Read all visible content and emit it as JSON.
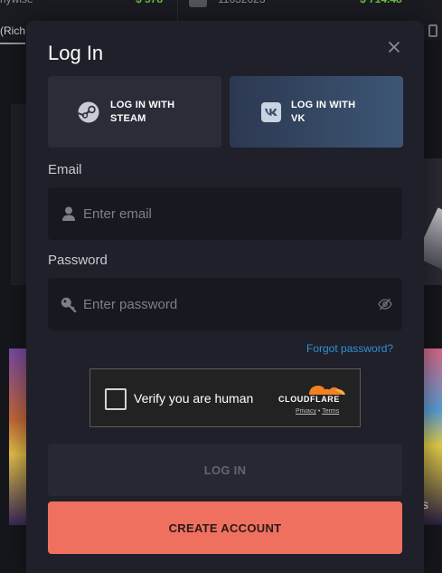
{
  "background": {
    "top_row": [
      {
        "user": "nywise",
        "amount": "$ 578"
      },
      {
        "user": "11632023",
        "amount": "$ 714.48"
      }
    ],
    "active_tab": "(Rich",
    "side_card_text": "ts"
  },
  "modal": {
    "title": "Log In",
    "close_icon": "close-icon",
    "social": {
      "steam": {
        "label_line1": "LOG IN WITH",
        "label_line2": "STEAM",
        "icon": "steam-icon"
      },
      "vk": {
        "label_line1": "LOG IN WITH",
        "label_line2": "VK",
        "icon": "vk-icon"
      }
    },
    "email": {
      "label": "Email",
      "value": "",
      "placeholder": "Enter email",
      "icon": "user-icon"
    },
    "password": {
      "label": "Password",
      "value": "",
      "placeholder": "Enter password",
      "icon": "key-icon",
      "toggle_icon": "eye-off-icon"
    },
    "forgot_password": "Forgot password?",
    "captcha": {
      "text": "Verify you are human",
      "brand": "CLOUDFLARE",
      "privacy": "Privacy",
      "separator": "•",
      "terms": "Terms",
      "checked": false
    },
    "login_button": "LOG IN",
    "create_account_button": "CREATE ACCOUNT"
  },
  "colors": {
    "modal_bg": "#1f2029",
    "accent_create": "#f07060",
    "link": "#2f8fd6",
    "positive_amount": "#6bbf3f",
    "cloudflare_orange": "#f38020"
  }
}
